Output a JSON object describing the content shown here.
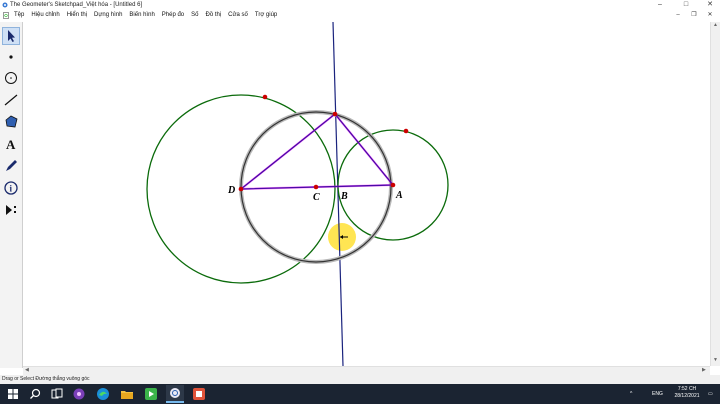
{
  "window": {
    "title": "The Geometer's Sketchpad_Việt hóa - [Untitled 6]",
    "controls": {
      "minimize": "–",
      "maximize": "□",
      "close": "✕"
    },
    "doc_controls": {
      "minimize": "–",
      "restore": "❐",
      "close": "✕"
    }
  },
  "menu": {
    "items": [
      "Tệp",
      "Hiệu chỉnh",
      "Hiển thị",
      "Dựng hình",
      "Biến hình",
      "Phép đo",
      "Số",
      "Đồ thị",
      "Cửa số",
      "Trợ giúp"
    ]
  },
  "toolbox": {
    "tools": [
      {
        "name": "selection-arrow-tool",
        "icon": "arrow-icon",
        "selected": true
      },
      {
        "name": "point-tool",
        "icon": "point-icon"
      },
      {
        "name": "compass-tool",
        "icon": "circle-icon"
      },
      {
        "name": "straightedge-tool",
        "icon": "line-icon"
      },
      {
        "name": "polygon-tool",
        "icon": "polygon-icon"
      },
      {
        "name": "text-tool",
        "icon": "text-A-icon",
        "glyph": "A"
      },
      {
        "name": "marker-tool",
        "icon": "pen-icon"
      },
      {
        "name": "information-tool",
        "icon": "info-icon",
        "glyph": "i"
      },
      {
        "name": "custom-tool",
        "icon": "play-menu-icon"
      }
    ]
  },
  "sketch": {
    "points": [
      {
        "label": "D"
      },
      {
        "label": "C"
      },
      {
        "label": "B"
      },
      {
        "label": "A"
      }
    ],
    "colors": {
      "circle": "#0b6b0b",
      "triangle": "#4b0aa8",
      "line": "#1a237e",
      "point": "#cc0000",
      "cursor_highlight": "#ffe135"
    }
  },
  "status_bar": {
    "text": "Drag or Select Đường thẳng vuông góc"
  },
  "taskbar": {
    "icons": [
      "windows-start-icon",
      "search-icon",
      "task-view-icon",
      "media-app-icon",
      "edge-browser-icon",
      "file-explorer-icon",
      "camtasia-icon",
      "sketchpad-icon",
      "app-icon"
    ],
    "tray": {
      "language": "ENG"
    },
    "clock": {
      "time": "7:52 CH",
      "date": "28/12/2021"
    }
  }
}
